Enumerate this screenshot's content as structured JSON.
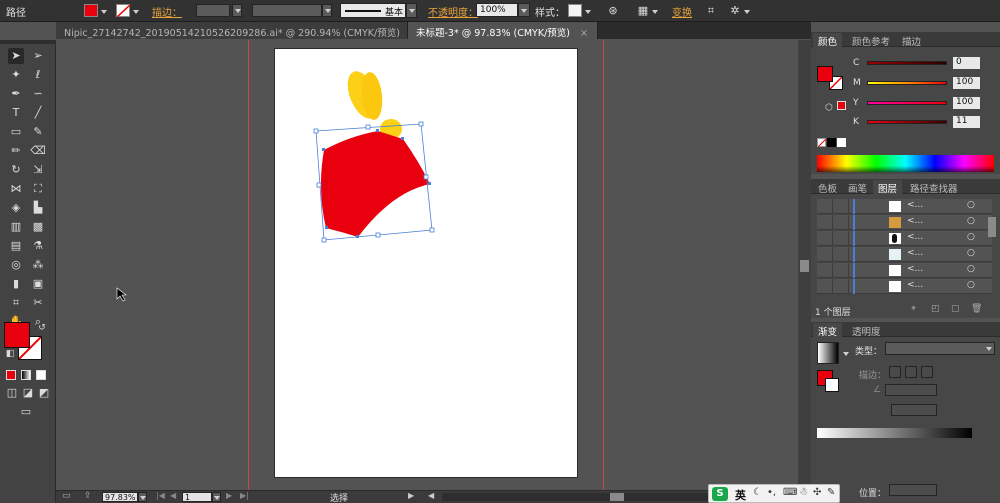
{
  "control_bar": {
    "mode_label": "路径",
    "stroke_label": "描边：",
    "stroke_profile": "基本",
    "opacity_label": "不透明度：",
    "opacity_value": "100%",
    "style_label": "样式：",
    "transform_label": "变换"
  },
  "tabs": [
    {
      "label": "Nipic_27142742_20190514210526209286.ai* @ 290.94% (CMYK/预览)",
      "close": "×"
    },
    {
      "label": "未标题-3* @ 97.83% (CMYK/预览)",
      "close": "×"
    }
  ],
  "color_panel": {
    "tabs": [
      "颜色",
      "颜色参考",
      "描边"
    ],
    "channels": [
      {
        "label": "C",
        "value": "0"
      },
      {
        "label": "M",
        "value": "100"
      },
      {
        "label": "Y",
        "value": "100"
      },
      {
        "label": "K",
        "value": "11"
      }
    ]
  },
  "layers_panel": {
    "tabs": [
      "色板",
      "画笔",
      "图层",
      "路径查找器"
    ],
    "rows": [
      {
        "name": "<..."
      },
      {
        "name": "<..."
      },
      {
        "name": "<..."
      },
      {
        "name": "<..."
      },
      {
        "name": "<..."
      },
      {
        "name": "<..."
      }
    ],
    "footer": "1 个图层"
  },
  "gradient_panel": {
    "tabs": [
      "渐变",
      "透明度"
    ],
    "type_label": "类型：",
    "stroke_label": "描边：",
    "position_label": "位置："
  },
  "status_bar": {
    "zoom": "97.83%",
    "page": "1",
    "tool": "选择"
  },
  "colors": {
    "fill": "#e8000f",
    "accent": "#e8a33d",
    "yellow": "#fcd016",
    "selection": "#4a7fd8"
  },
  "taskbar": {
    "ime_label": "英"
  }
}
